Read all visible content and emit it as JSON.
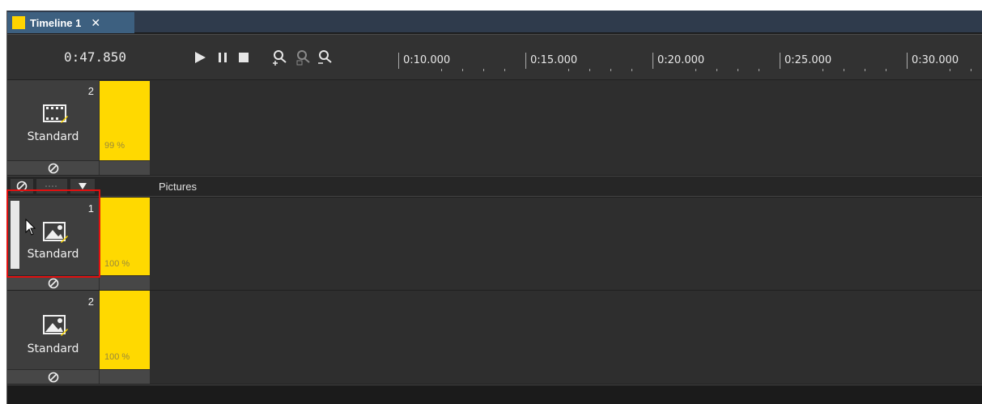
{
  "tab": {
    "label": "Timeline 1",
    "close": "✕",
    "color": "#ffd400"
  },
  "transport": {
    "timecode": "0:47.850"
  },
  "ruler": [
    "0:10.000",
    "0:15.000",
    "0:20.000",
    "0:25.000",
    "0:30.000"
  ],
  "tracks": [
    {
      "number": "2",
      "name": "Standard",
      "icon": "video-icon",
      "level_label": "99 %",
      "level": 0.99
    },
    {
      "number": "1",
      "name": "Standard",
      "icon": "picture-icon",
      "level_label": "100 %",
      "level": 1.0
    },
    {
      "number": "2",
      "name": "Standard",
      "icon": "picture-icon",
      "level_label": "100 %",
      "level": 1.0
    }
  ],
  "group": {
    "label": "Pictures"
  },
  "colors": {
    "accent": "#ffd900",
    "highlight": "#e01010",
    "tab": "#3d6080"
  }
}
